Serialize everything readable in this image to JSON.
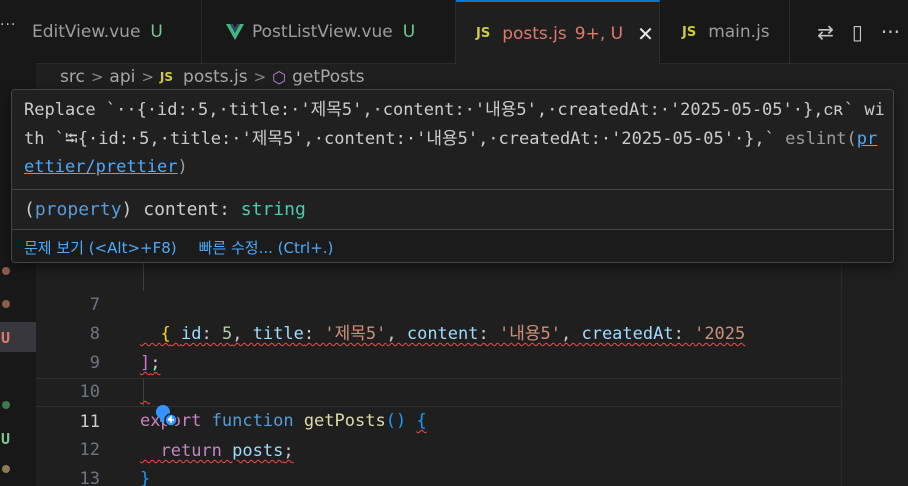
{
  "tabs": [
    {
      "label": "EditView.vue",
      "git": "U",
      "icon": "vue-icon"
    },
    {
      "label": "PostListView.vue",
      "git": "U",
      "icon": "vue-icon"
    },
    {
      "label": "posts.js",
      "git": "9+, U",
      "icon": "js-icon",
      "badge": "JS",
      "active": true
    },
    {
      "label": "main.js",
      "git": "",
      "icon": "js-icon",
      "badge": "JS"
    }
  ],
  "tab_actions": {
    "compare": "⇄",
    "split": "▯",
    "more": "···"
  },
  "left_strip": {
    "more": "···",
    "git_u": "U",
    "git_u2": "U"
  },
  "breadcrumb": {
    "src": "src",
    "api": "api",
    "file_badge": "JS",
    "file": "posts.js",
    "symbol": "getPosts",
    "sep": ">"
  },
  "hover": {
    "message_text": "Replace `··{·id:·5,·title:·'제목5',·content:·'내용5',·createdAt:·'2025-05-05'·},ᴄʀ` with `⭾{·id:·5,·title:·'제목5',·content:·'내용5',·createdAt:·'2025-05-05'·},`",
    "source_prefix": " eslint(",
    "source_link": "prettier/prettier",
    "source_suffix": ")",
    "type_paren_open": "(",
    "type_kind": "property",
    "type_paren_close": ")",
    "type_name": " content: ",
    "type_type": "string",
    "action_view_problem": "문제 보기 (<Alt>+F8)",
    "action_quick_fix": "빠른 수정... (Ctrl+.)"
  },
  "code_lines": [
    {
      "num": "7"
    },
    {
      "num": "8"
    },
    {
      "num": "9"
    },
    {
      "num": "10"
    },
    {
      "num": "11",
      "current": true
    },
    {
      "num": "12"
    },
    {
      "num": "13"
    }
  ],
  "code": {
    "l7_brace": "{",
    "l7_id_key": "id",
    "l7_id_val": "5",
    "l7_title_key": "title",
    "l7_title_val": "'제목5'",
    "l7_content_key": "content",
    "l7_content_val": "'내용5'",
    "l7_created_key": "createdAt",
    "l7_created_val": "'2025",
    "l8_bracket": "]",
    "l8_semi": ";",
    "l10_export": "export",
    "l10_function": "function",
    "l10_name": "getPosts",
    "l10_parens": "()",
    "l10_brace": "{",
    "l11_return": "return",
    "l11_var": "posts",
    "l11_semi": ";",
    "l12_brace": "}"
  },
  "colors": {
    "accent": "#0078d4",
    "error": "#f14c4c",
    "git_untracked": "#73c991",
    "tab_modified": "#e07a6a"
  }
}
